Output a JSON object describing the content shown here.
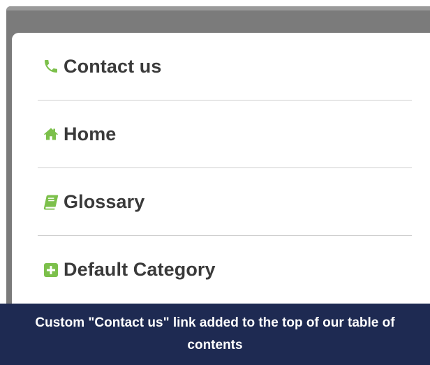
{
  "toc": {
    "items": [
      {
        "label": "Contact us",
        "icon": "phone-icon"
      },
      {
        "label": "Home",
        "icon": "home-icon"
      },
      {
        "label": "Glossary",
        "icon": "book-icon"
      },
      {
        "label": "Default Category",
        "icon": "plus-square-icon"
      }
    ]
  },
  "caption": {
    "text": "Custom \"Contact us\" link added to the top of our table of contents"
  },
  "colors": {
    "accent_green": "#7cc04b",
    "caption_background": "#1e2a52",
    "backdrop_gray": "#7b7b7b",
    "label_text": "#3a3a3a"
  }
}
